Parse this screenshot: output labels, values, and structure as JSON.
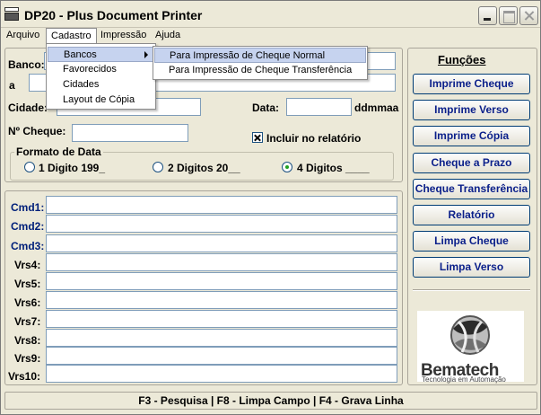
{
  "window": {
    "title": "DP20 - Plus Document Printer",
    "icon": "printer-app-icon"
  },
  "menubar": {
    "items": [
      "Arquivo",
      "Cadastro",
      "Impressão",
      "Ajuda"
    ]
  },
  "cadastro_menu": {
    "items": [
      "Bancos",
      "Favorecidos",
      "Cidades",
      "Layout de Cópia"
    ]
  },
  "bancos_submenu": {
    "items": [
      "Para Impressão de Cheque Normal",
      "Para Impressão de Cheque Transferência"
    ]
  },
  "form": {
    "banco_label": "Banco:",
    "a_label": "a",
    "cidade_label": "Cidade:",
    "data_label": "Data:",
    "data_format": "ddmmaa",
    "cheque_label": "Nº Cheque:",
    "incluir_label": "Incluir no relatório",
    "incluir_checked": true,
    "formato_title": "Formato de Data",
    "formato_options": [
      "1 Digito 199_",
      "2 Digitos 20__",
      "4 Digitos ____"
    ],
    "formato_selected": 2
  },
  "commands": {
    "labels": [
      "Cmd1:",
      "Cmd2:",
      "Cmd3:",
      "Vrs4:",
      "Vrs5:",
      "Vrs6:",
      "Vrs7:",
      "Vrs8:",
      "Vrs9:",
      "Vrs10:"
    ]
  },
  "funcoes": {
    "title": "Funções",
    "buttons": [
      "Imprime Cheque",
      "Imprime Verso",
      "Imprime Cópia",
      "Cheque a Prazo",
      "Cheque Transferência",
      "Relatório",
      "Limpa Cheque",
      "Limpa Verso"
    ]
  },
  "logo": {
    "name": "Bematech",
    "tagline": "Tecnologia em Automação"
  },
  "status": {
    "text": "F3 - Pesquisa  |  F8 - Limpa Campo  |  F4 - Grava Linha"
  },
  "colors": {
    "accent_text": "#0a1f8a",
    "window_bg": "#ece9d8",
    "highlight": "#c6d3ef"
  }
}
